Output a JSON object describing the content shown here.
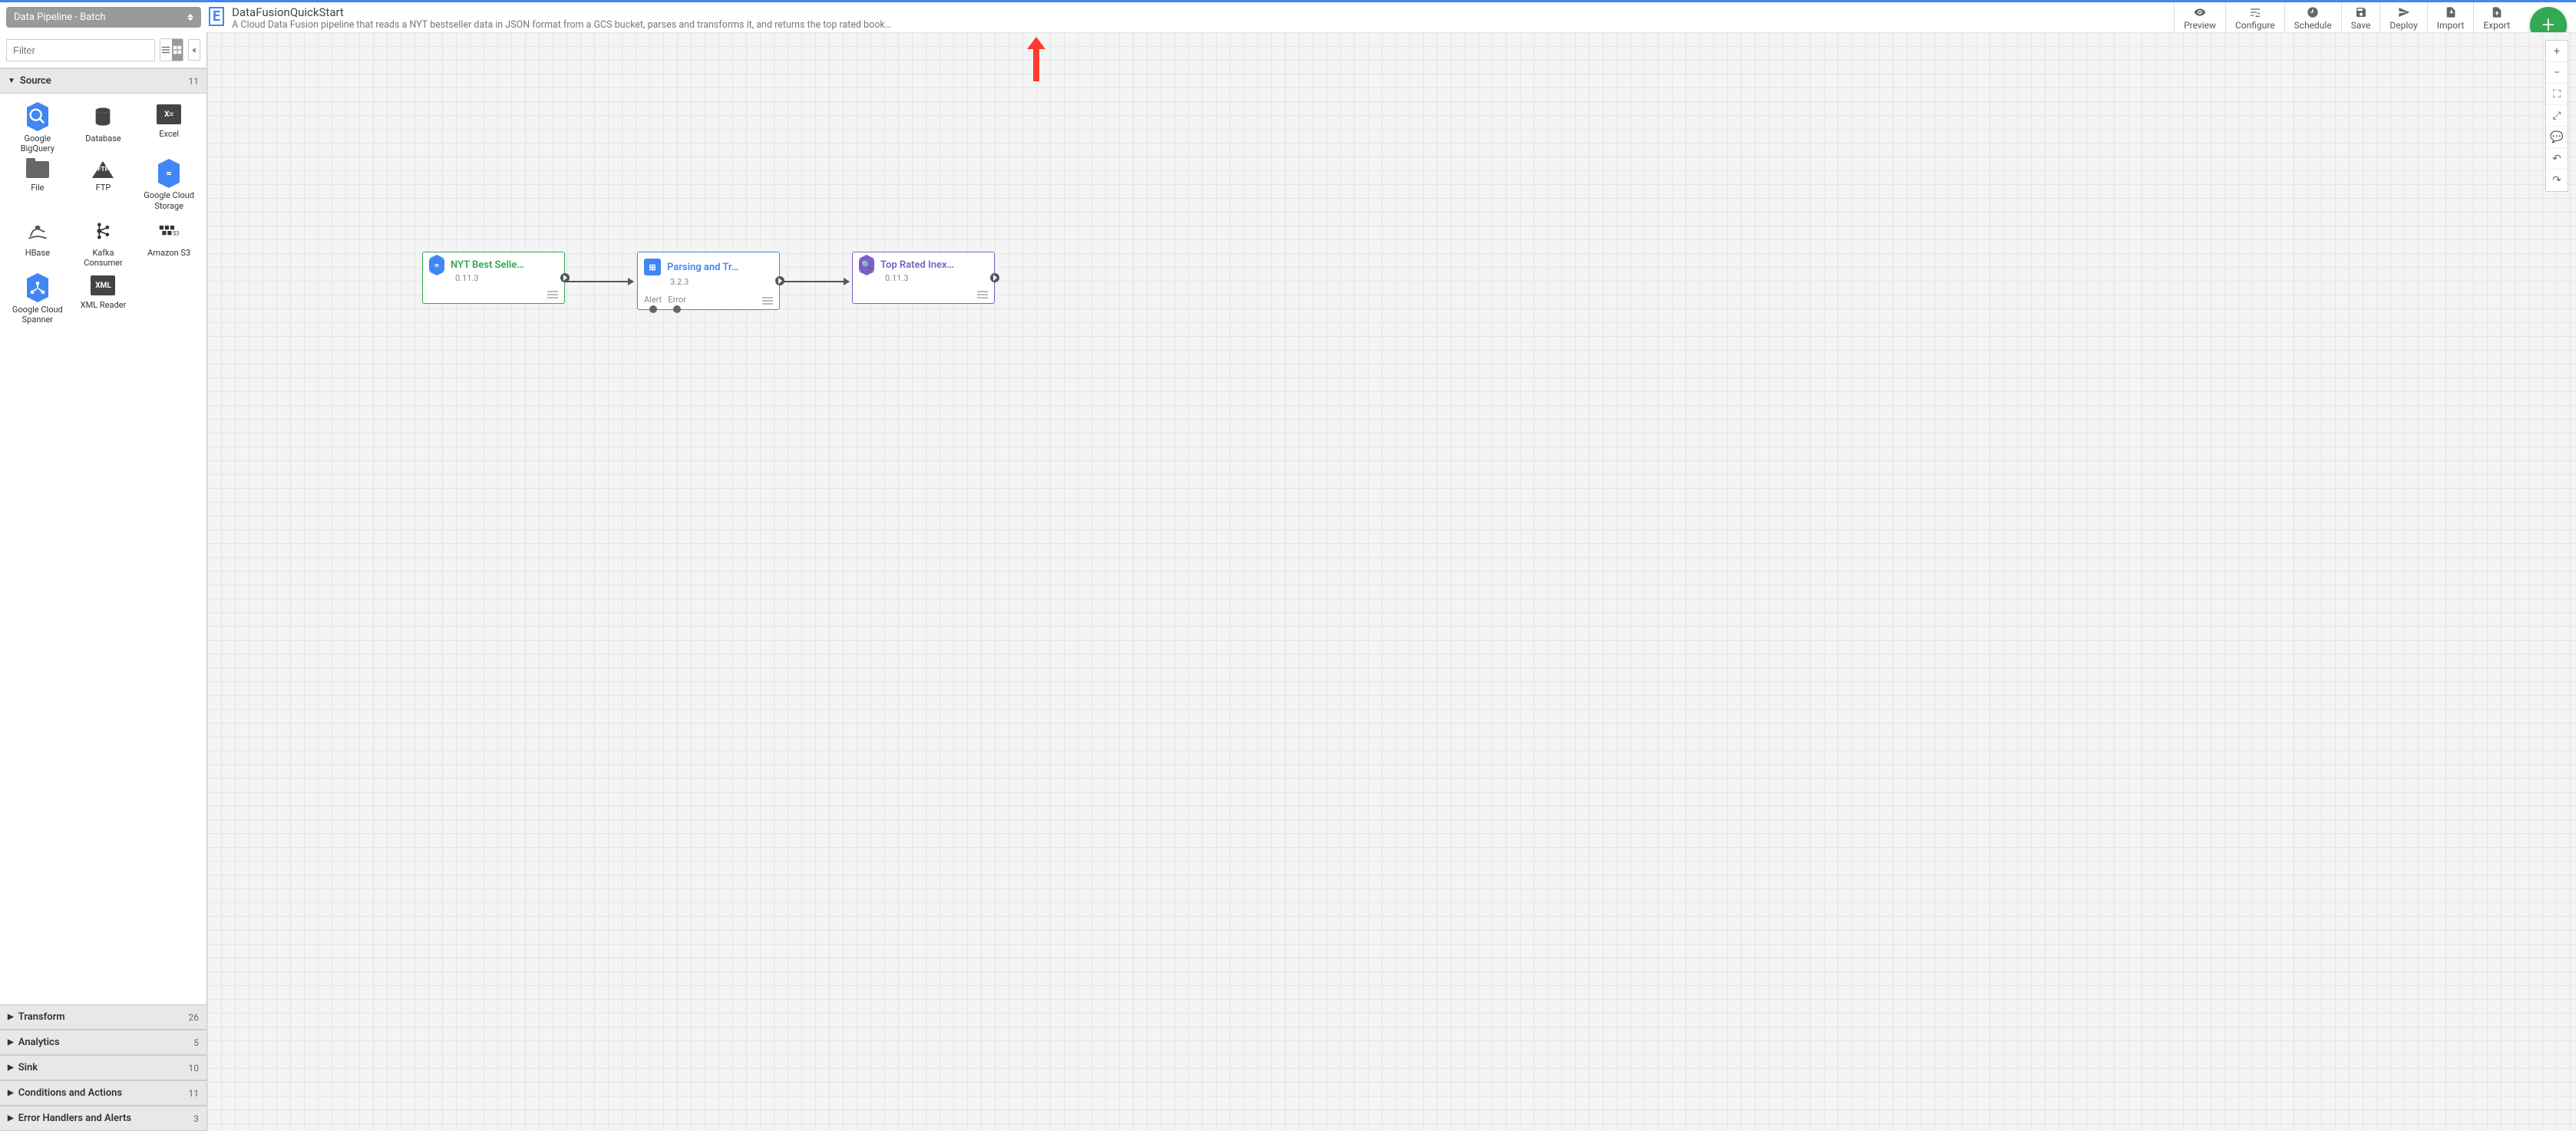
{
  "header": {
    "dropdown_label": "Data Pipeline - Batch",
    "pipeline_name": "DataFusionQuickStart",
    "pipeline_desc": "A Cloud Data Fusion pipeline that reads a NYT bestseller data in JSON format from a GCS bucket, parses and transforms it, and returns the top rated book…",
    "actions": {
      "preview": "Preview",
      "configure": "Configure",
      "schedule": "Schedule",
      "save": "Save",
      "deploy": "Deploy",
      "import": "Import",
      "export": "Export"
    }
  },
  "sidebar": {
    "filter_placeholder": "Filter",
    "sections": {
      "source": {
        "label": "Source",
        "count": "11",
        "open": true
      },
      "transform": {
        "label": "Transform",
        "count": "26"
      },
      "analytics": {
        "label": "Analytics",
        "count": "5"
      },
      "sink": {
        "label": "Sink",
        "count": "10"
      },
      "conditions": {
        "label": "Conditions and Actions",
        "count": "11"
      },
      "errors": {
        "label": "Error Handlers and Alerts",
        "count": "3"
      }
    },
    "source_items": [
      {
        "label": "Google BigQuery"
      },
      {
        "label": "Database"
      },
      {
        "label": "Excel"
      },
      {
        "label": "File"
      },
      {
        "label": "FTP"
      },
      {
        "label": "Google Cloud Storage"
      },
      {
        "label": "HBase"
      },
      {
        "label": "Kafka Consumer"
      },
      {
        "label": "Amazon S3"
      },
      {
        "label": "Google Cloud Spanner"
      },
      {
        "label": "XML Reader"
      }
    ]
  },
  "nodes": {
    "n1": {
      "title": "NYT Best Selle…",
      "version": "0.11.3"
    },
    "n2": {
      "title": "Parsing and Tr…",
      "version": "3.2.3",
      "port_alert": "Alert",
      "port_error": "Error"
    },
    "n3": {
      "title": "Top Rated Inex…",
      "version": "0.11.3"
    }
  }
}
